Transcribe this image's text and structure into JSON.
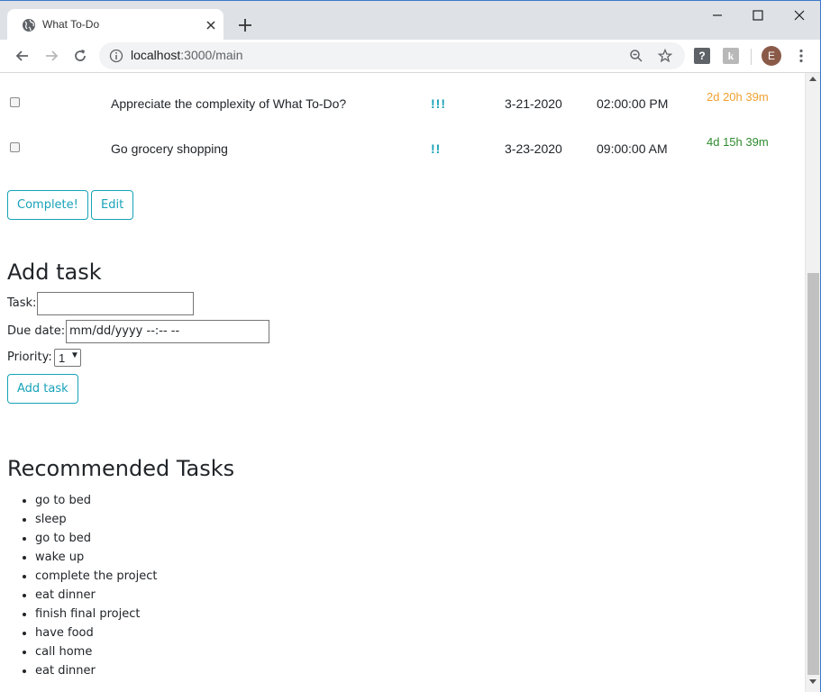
{
  "browser": {
    "tab_title": "What To-Do",
    "url_host": "localhost",
    "url_path": ":3000/main",
    "avatar_letter": "E",
    "ext1_label": "?",
    "ext2_label": "k"
  },
  "tasks": [
    {
      "name": "Appreciate the complexity of What To-Do?",
      "priority": "!!!",
      "date": "3-21-2020",
      "time": "02:00:00 PM",
      "remaining": "2d 20h 39m",
      "remaining_color": "#f0a030"
    },
    {
      "name": "Go grocery shopping",
      "priority": "!!",
      "date": "3-23-2020",
      "time": "09:00:00 AM",
      "remaining": "4d 15h 39m",
      "remaining_color": "#2e8b2e"
    }
  ],
  "actions": {
    "complete_label": "Complete!",
    "edit_label": "Edit"
  },
  "add_task": {
    "title": "Add task",
    "task_label": "Task:",
    "task_value": "",
    "due_label": "Due date:",
    "due_placeholder": "mm/dd/yyyy --:-- --",
    "priority_label": "Priority:",
    "priority_value": "1",
    "submit_label": "Add task"
  },
  "recommended": {
    "title": "Recommended Tasks",
    "items": [
      "go to bed",
      "sleep",
      "go to bed",
      "wake up",
      "complete the project",
      "eat dinner",
      "finish final project",
      "have food",
      "call home",
      "eat dinner"
    ]
  },
  "colors": {
    "accent": "#17a2b8",
    "window_border": "#3a78c8"
  }
}
